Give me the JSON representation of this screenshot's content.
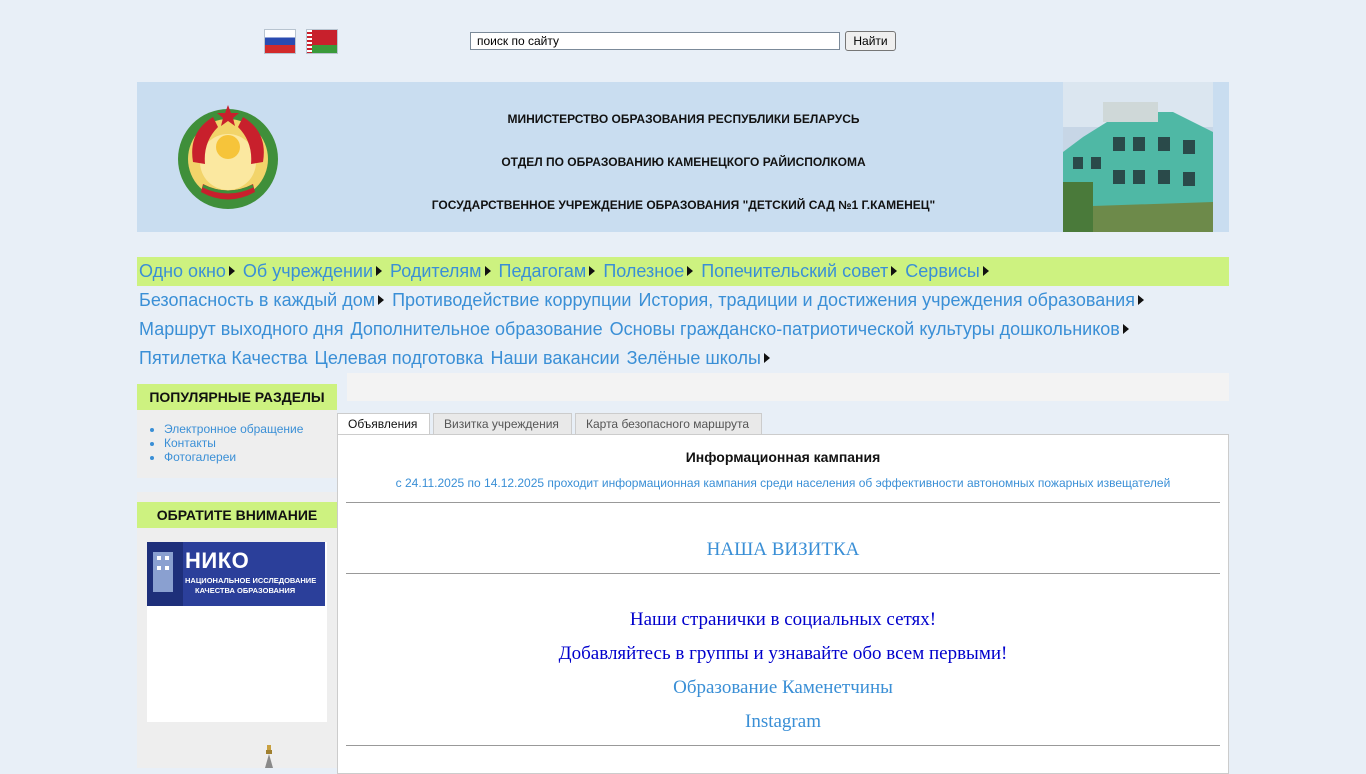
{
  "top": {
    "search_placeholder": "поиск по сайту",
    "search_value": "поиск по сайту",
    "search_button": "Найти",
    "flags": [
      "russian-flag-icon",
      "belarus-flag-icon"
    ]
  },
  "header": {
    "line1": "МИНИСТЕРСТВО ОБРАЗОВАНИЯ РЕСПУБЛИКИ БЕЛАРУСЬ",
    "line2": "ОТДЕЛ ПО  ОБРАЗОВАНИЮ  КАМЕНЕЦКОГО РАЙИСПОЛКОМА",
    "line3": "ГОСУДАРСТВЕННОЕ УЧРЕЖДЕНИЕ ОБРАЗОВАНИЯ \"ДЕТСКИЙ САД №1  Г.КАМЕНЕЦ\""
  },
  "nav": {
    "row1": [
      {
        "label": "Одно окно",
        "arrow": true
      },
      {
        "label": "Об учреждении",
        "arrow": true
      },
      {
        "label": "Родителям",
        "arrow": true
      },
      {
        "label": "Педагогам",
        "arrow": true
      },
      {
        "label": "Полезное",
        "arrow": true
      },
      {
        "label": "Попечительский совет",
        "arrow": true
      },
      {
        "label": "Сервисы",
        "arrow": true
      }
    ],
    "row2": [
      {
        "label": "Безопасность в каждый дом",
        "arrow": true
      },
      {
        "label": "Противодействие коррупции",
        "arrow": false
      },
      {
        "label": "История, традиции и достижения учреждения образования",
        "arrow": true
      }
    ],
    "row3": [
      {
        "label": "Маршрут выходного дня",
        "arrow": false
      },
      {
        "label": "Дополнительное образование",
        "arrow": false
      },
      {
        "label": "Основы гражданско-патриотической культуры дошкольников",
        "arrow": true
      }
    ],
    "row4": [
      {
        "label": "Пятилетка Качества",
        "arrow": false
      },
      {
        "label": "Целевая подготовка",
        "arrow": false
      },
      {
        "label": "Наши вакансии",
        "arrow": false
      },
      {
        "label": "Зелёные школы",
        "arrow": true
      }
    ]
  },
  "sidebar": {
    "popular_title": "ПОПУЛЯРНЫЕ РАЗДЕЛЫ",
    "popular_items": [
      "Электронное обращение",
      "Контакты",
      "Фотогалереи"
    ],
    "attention_title": "ОБРАТИТЕ ВНИМАНИЕ",
    "niko_title": "НИКО",
    "niko_sub1": "НАЦИОНАЛЬНОЕ ИССЛЕДОВАНИЕ",
    "niko_sub2": "КАЧЕСТВА ОБРАЗОВАНИЯ"
  },
  "tabs": [
    "Объявления",
    "Визитка учреждения",
    "Карта безопасного маршрута"
  ],
  "content": {
    "announcement_title": "Информационная кампания",
    "announcement_text": "с 24.11.2025 по 14.12.2025 проходит информационная кампания среди населения об эффективности автономных пожарных извещателей",
    "visit_title": "НАША ВИЗИТКА",
    "social_line1": "Наши странички в социальных сетях!",
    "social_line2": "Добавляйтесь в группы и узнавайте обо всем первыми!",
    "link1": "Образование Каменетчины",
    "link2": "Instagram"
  },
  "colors": {
    "page_bg": "#e8eff7",
    "header_bg": "#c9ddf0",
    "nav_green": "#cdf280",
    "link_blue": "#3a8fd6",
    "dark_blue": "#0000cc"
  }
}
